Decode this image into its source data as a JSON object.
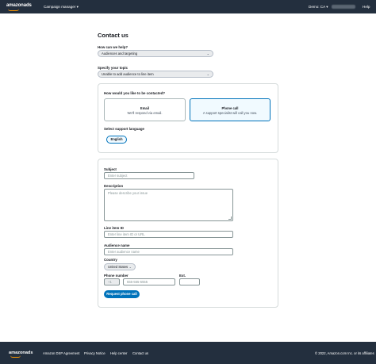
{
  "topbar": {
    "logo": "amazonads",
    "nav": "Campaign manager",
    "nav_chevron": "▾",
    "account": "Demo: CA",
    "account_chevron": "▾",
    "help": "Help"
  },
  "page": {
    "title": "Contact us"
  },
  "help_topic": {
    "label": "How can we help?",
    "value": "Audiences and targeting"
  },
  "specific_topic": {
    "label": "Specify your topic",
    "value": "Unable to add audience to line item"
  },
  "contact_method": {
    "label": "How would you like to be contacted?",
    "options": [
      {
        "title": "Email",
        "description": "We'll respond via email."
      },
      {
        "title": "Phone call",
        "description": "A support specialist will call you now."
      }
    ],
    "selected": "Phone call"
  },
  "language": {
    "label": "Select support language",
    "value": "English"
  },
  "form": {
    "subject_label": "Subject",
    "subject_placeholder": "Enter subject",
    "description_label": "Description",
    "description_placeholder": "Please describe your issue",
    "line_item_label": "Line item ID",
    "line_item_placeholder": "Enter line item ID or URL",
    "audience_label": "Audience name",
    "audience_placeholder": "Enter audience name",
    "country_label": "Country",
    "country_value": "United States",
    "phone_label": "Phone number",
    "phone_code": "+1",
    "phone_placeholder": "555-555-5555",
    "ext_label": "Ext.",
    "submit_label": "Request phone call"
  },
  "footer": {
    "logo": "amazonads",
    "links": [
      "Amazon DSP Agreement",
      "Privacy Notice",
      "Help center",
      "Contact us"
    ],
    "copyright": "© 2022, Amazon.com Inc. or its affiliates"
  },
  "colors": {
    "topbar": "#232f3e",
    "primary": "#0073bb",
    "accent": "#ff9900"
  }
}
